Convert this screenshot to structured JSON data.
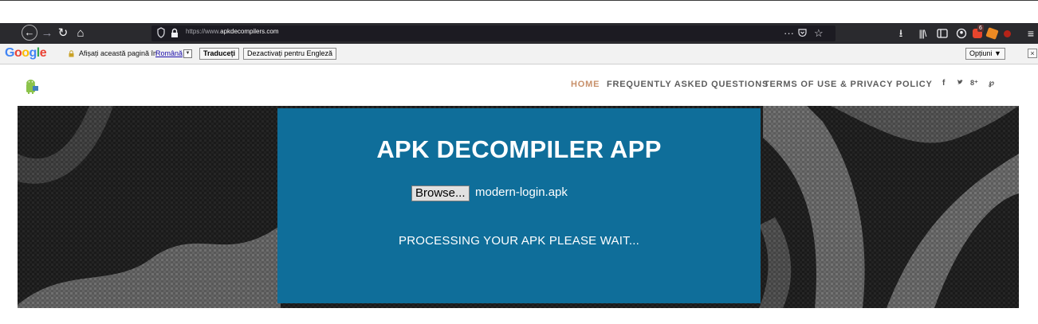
{
  "browser": {
    "url_prefix": "https://www.",
    "url_domain": "apkdecompilers.com",
    "icons": {
      "back": "arrow-left-icon",
      "forward": "arrow-right-icon",
      "reload": "reload-icon",
      "home": "home-icon",
      "more": "ellipsis-icon",
      "pocket": "pocket-icon",
      "bookmark": "star-icon",
      "download": "download-icon",
      "library": "library-icon",
      "sidebar": "sidebar-icon",
      "account": "account-icon",
      "menu": "hamburger-menu-icon"
    },
    "extension_badge": "6"
  },
  "translate_bar": {
    "logo": "Google",
    "prompt": "Afișați această pagină în",
    "language": "Română",
    "translate_label": "Traduceți",
    "disable_label": "Dezactivați pentru Engleză",
    "options_label": "Opțiuni ▼",
    "close_label": "×"
  },
  "site": {
    "nav": {
      "home": "HOME",
      "faq": "FREQUENTLY ASKED QUESTIONS",
      "terms": "TERMS OF USE & PRIVACY POLICY"
    },
    "social": {
      "facebook": "f",
      "twitter": "🐦",
      "googleplus": "8⁺",
      "pinterest": "℘"
    }
  },
  "hero": {
    "title": "APK DECOMPILER APP",
    "browse_label": "Browse...",
    "file_name": "modern-login.apk",
    "status": "PROCESSING YOUR APK PLEASE WAIT..."
  },
  "colors": {
    "toolbar": "#2a2a2e",
    "panel": "#0f6e9a",
    "nav_active": "#c8906a"
  }
}
